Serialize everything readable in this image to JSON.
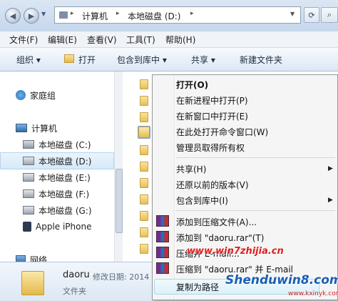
{
  "address": {
    "path": [
      "计算机",
      "本地磁盘 (D:)"
    ],
    "icons": {
      "back": "back-arrow-icon",
      "forward": "forward-arrow-icon",
      "refresh": "refresh-icon"
    }
  },
  "menubar": [
    {
      "label": "文件(F)"
    },
    {
      "label": "编辑(E)"
    },
    {
      "label": "查看(V)"
    },
    {
      "label": "工具(T)"
    },
    {
      "label": "帮助(H)"
    }
  ],
  "commandbar": {
    "organize": "组织 ▾",
    "open": "打开",
    "include": "包含到库中 ▾",
    "share": "共享 ▾",
    "new_folder": "新建文件夹"
  },
  "navpane": {
    "homegroup": "家庭组",
    "computer": "计算机",
    "drives": [
      "本地磁盘 (C:)",
      "本地磁盘 (D:)",
      "本地磁盘 (E:)",
      "本地磁盘 (F:)",
      "本地磁盘 (G:)"
    ],
    "device": "Apple iPhone",
    "network": "网络"
  },
  "context_menu": {
    "items": [
      {
        "label": "打开(O)",
        "bold": true
      },
      {
        "label": "在新进程中打开(P)"
      },
      {
        "label": "在新窗口中打开(E)"
      },
      {
        "label": "在此处打开命令窗口(W)"
      },
      {
        "label": "管理员取得所有权"
      },
      {
        "label": "共享(H)",
        "submenu": true
      },
      {
        "label": "还原以前的版本(V)"
      },
      {
        "label": "包含到库中(I)",
        "submenu": true
      },
      {
        "label": "添加到压缩文件(A)..."
      },
      {
        "label": "添加到 \"daoru.rar\"(T)"
      },
      {
        "label": "压缩并 E-mail..."
      },
      {
        "label": "压缩到 \"daoru.rar\" 并 E-mail"
      },
      {
        "label": "复制为路径"
      }
    ]
  },
  "details": {
    "name": "daoru",
    "modified_label": "修改日期: 2014",
    "type": "文件夹"
  },
  "watermark": {
    "url": "www.win7zhijia.cn",
    "site": "Shenduwin8.com",
    "site2": "www.kxinyk.com"
  },
  "colors": {
    "addr_bar": "#c6d7ec",
    "highlight": "#dcf1fb",
    "watermark_red": "#e01c1c",
    "watermark_blue": "#1a5fb4"
  }
}
